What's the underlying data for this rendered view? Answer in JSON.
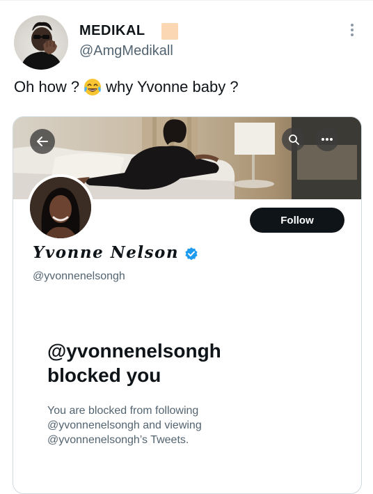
{
  "tweet": {
    "author_name": "MEDIKAL",
    "author_handle": "@AmgMedikall",
    "text_before_emoji": "Oh how ?",
    "emoji": "face-with-tears-of-joy",
    "text_after_emoji": "why Yvonne baby ?",
    "badge_color": "#fbd8b3"
  },
  "embedded_profile": {
    "display_name": "Yvonne Nelson",
    "handle": "@yvonnenelsongh",
    "follow_label": "Follow",
    "verified": true,
    "verified_color": "#1d9bf0",
    "blocked_title_line1": "@yvonnenelsongh",
    "blocked_title_line2": "blocked you",
    "blocked_desc_line1": "You are blocked from following",
    "blocked_desc_line2": "@yvonnenelsongh and viewing",
    "blocked_desc_line3": "@yvonnenelsongh’s Tweets."
  },
  "icons": {
    "back": "arrow-left-icon",
    "search": "search-icon",
    "menu": "more-horizontal-icon",
    "tweet_menu": "more-vertical-icon"
  }
}
